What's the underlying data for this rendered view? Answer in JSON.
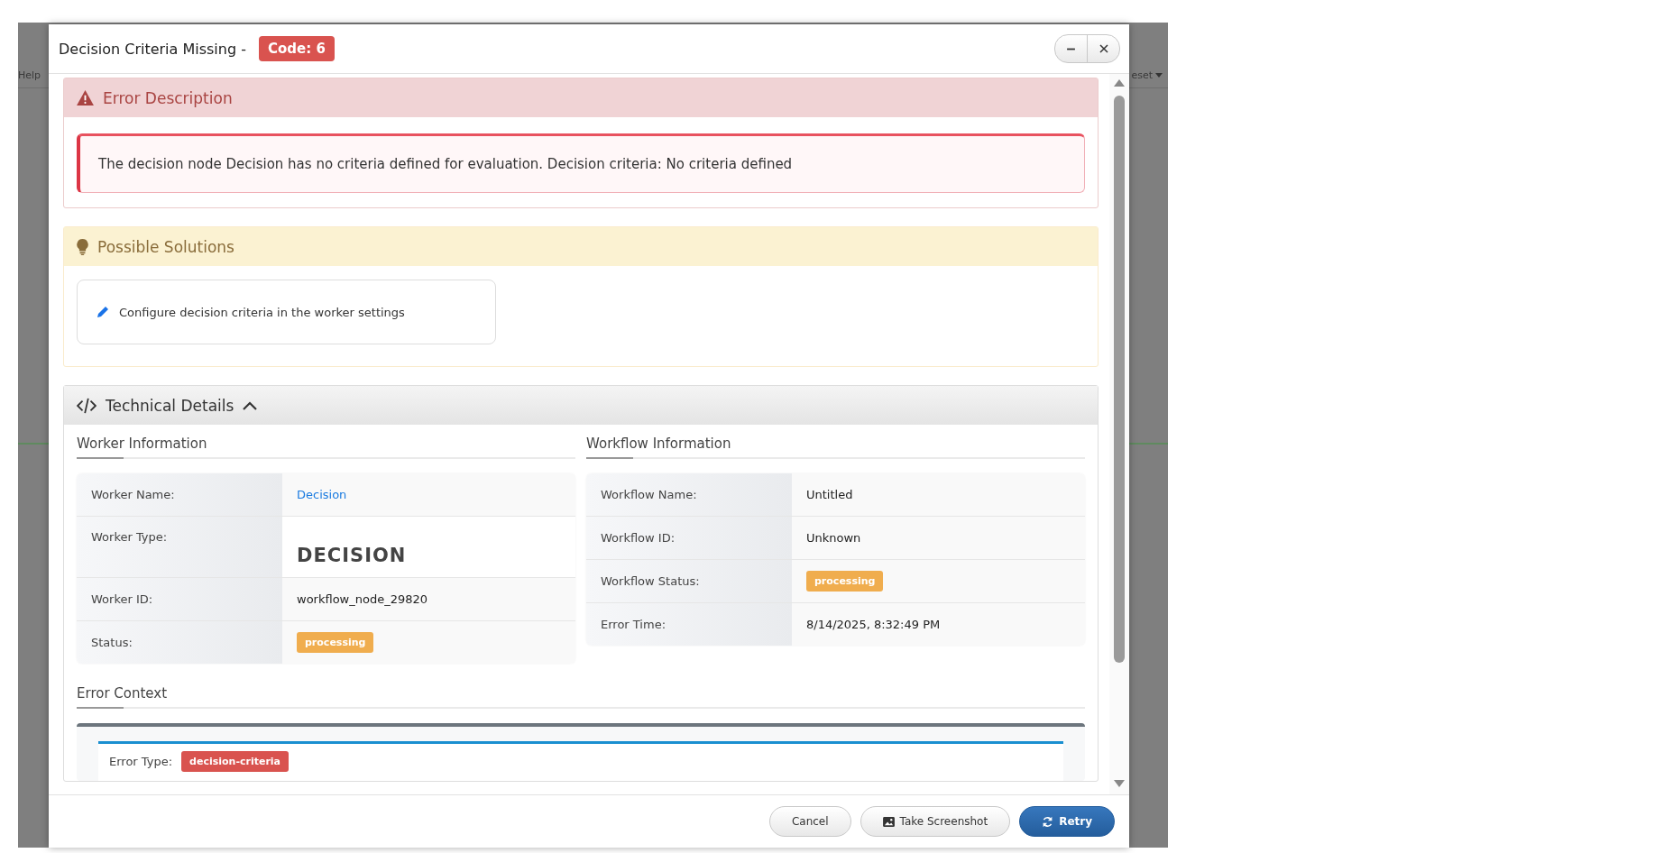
{
  "background_app": {
    "menu_left": "Help",
    "menu_right": "eset"
  },
  "dialog": {
    "title": "Decision Criteria Missing -",
    "code_badge": "Code: 6"
  },
  "error_description": {
    "heading": "Error Description",
    "message": "The decision node Decision has no criteria defined for evaluation. Decision criteria: No criteria defined"
  },
  "possible_solutions": {
    "heading": "Possible Solutions",
    "items": [
      "Configure decision criteria in the worker settings"
    ]
  },
  "technical_details": {
    "heading": "Technical Details",
    "expanded": true,
    "worker_information": {
      "heading": "Worker Information",
      "rows": [
        {
          "label": "Worker Name:",
          "value": "Decision",
          "kind": "link"
        },
        {
          "label": "Worker Type:",
          "value": "DECISION",
          "kind": "type"
        },
        {
          "label": "Worker ID:",
          "value": "workflow_node_29820",
          "kind": "text"
        },
        {
          "label": "Status:",
          "value": "processing",
          "kind": "badge",
          "color": "#f0ad4e"
        }
      ]
    },
    "workflow_information": {
      "heading": "Workflow Information",
      "rows": [
        {
          "label": "Workflow Name:",
          "value": "Untitled",
          "kind": "text"
        },
        {
          "label": "Workflow ID:",
          "value": "Unknown",
          "kind": "text"
        },
        {
          "label": "Workflow Status:",
          "value": "processing",
          "kind": "badge",
          "color": "#f0ad4e"
        },
        {
          "label": "Error Time:",
          "value": "8/14/2025, 8:32:49 PM",
          "kind": "text"
        }
      ]
    },
    "error_context": {
      "heading": "Error Context",
      "rows": [
        {
          "label": "Error Type:",
          "value": "decision-criteria",
          "kind": "badge",
          "color": "#d9534f"
        }
      ]
    }
  },
  "footer_buttons": [
    {
      "label": "Cancel",
      "kind": "default"
    },
    {
      "label": "Take Screenshot",
      "kind": "screenshot"
    },
    {
      "label": "Retry",
      "kind": "primary"
    }
  ]
}
